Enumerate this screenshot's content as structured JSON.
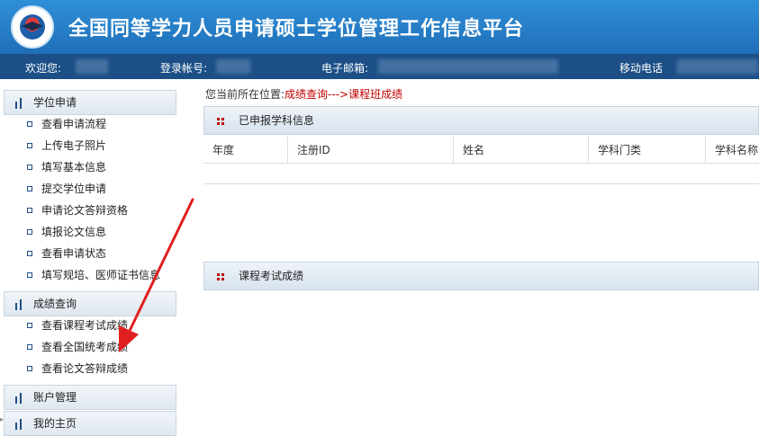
{
  "header": {
    "title": "全国同等学力人员申请硕士学位管理工作信息平台"
  },
  "infobar": {
    "welcome_label": "欢迎您:",
    "account_label": "登录帐号:",
    "email_label": "电子邮箱:",
    "mobile_label": "移动电话"
  },
  "sidebar": {
    "sections": [
      {
        "label": "学位申请",
        "items": [
          "查看申请流程",
          "上传电子照片",
          "填写基本信息",
          "提交学位申请",
          "申请论文答辩资格",
          "填报论文信息",
          "查看申请状态",
          "填写规培、医师证书信息"
        ]
      },
      {
        "label": "成绩查询",
        "items": [
          "查看课程考试成绩",
          "查看全国统考成绩",
          "查看论文答辩成绩"
        ]
      },
      {
        "label": "账户管理",
        "items": []
      },
      {
        "label": "我的主页",
        "items": []
      }
    ]
  },
  "main": {
    "breadcrumb_prefix": "您当前所在位置:",
    "breadcrumb_path": "成绩查询--->课程班成绩",
    "panel1_title": "已申报学科信息",
    "table_columns": [
      "年度",
      "注册ID",
      "姓名",
      "学科门类",
      "学科名称"
    ],
    "panel2_title": "课程考试成绩"
  },
  "colors": {
    "header_bg": "#2f8fd8",
    "infobar_bg": "#1b4f86",
    "breadcrumb_path": "#c00000",
    "arrow": "#e02020"
  }
}
